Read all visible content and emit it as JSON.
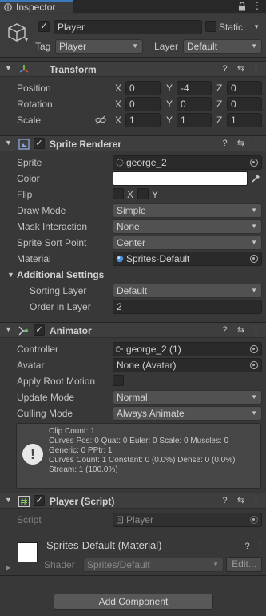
{
  "window": {
    "tab_title": "Inspector"
  },
  "object": {
    "name": "Player",
    "active": true,
    "static_label": "Static",
    "static_checked": false,
    "tag_label": "Tag",
    "tag_value": "Player",
    "layer_label": "Layer",
    "layer_value": "Default"
  },
  "transform": {
    "title": "Transform",
    "rows": [
      {
        "label": "Position",
        "x": "0",
        "y": "-4",
        "z": "0"
      },
      {
        "label": "Rotation",
        "x": "0",
        "y": "0",
        "z": "0"
      },
      {
        "label": "Scale",
        "x": "1",
        "y": "1",
        "z": "1"
      }
    ]
  },
  "sprite_renderer": {
    "title": "Sprite Renderer",
    "sprite_label": "Sprite",
    "sprite_value": "george_2",
    "color_label": "Color",
    "flip_label": "Flip",
    "flip_x": "X",
    "flip_y": "Y",
    "draw_mode_label": "Draw Mode",
    "draw_mode_value": "Simple",
    "mask_label": "Mask Interaction",
    "mask_value": "None",
    "sort_point_label": "Sprite Sort Point",
    "sort_point_value": "Center",
    "material_label": "Material",
    "material_value": "Sprites-Default",
    "additional_label": "Additional Settings",
    "sorting_layer_label": "Sorting Layer",
    "sorting_layer_value": "Default",
    "order_label": "Order in Layer",
    "order_value": "2"
  },
  "animator": {
    "title": "Animator",
    "controller_label": "Controller",
    "controller_value": "george_2 (1)",
    "avatar_label": "Avatar",
    "avatar_value": "None (Avatar)",
    "root_motion_label": "Apply Root Motion",
    "update_mode_label": "Update Mode",
    "update_mode_value": "Normal",
    "culling_label": "Culling Mode",
    "culling_value": "Always Animate",
    "info_lines": [
      "Clip Count: 1",
      "Curves Pos: 0 Quat: 0 Euler: 0 Scale: 0 Muscles: 0",
      "Generic: 0 PPtr: 1",
      "Curves Count: 1 Constant: 0 (0.0%) Dense: 0 (0.0%)",
      "Stream: 1 (100.0%)"
    ]
  },
  "player_script": {
    "title": "Player (Script)",
    "script_label": "Script",
    "script_value": "Player"
  },
  "material": {
    "title": "Sprites-Default (Material)",
    "shader_label": "Shader",
    "shader_value": "Sprites/Default",
    "edit_label": "Edit..."
  },
  "add_component_label": "Add Component",
  "icons": {
    "help": "?",
    "presets": "⇆",
    "menu": "⋮",
    "check": "✓",
    "fold_open": "▼",
    "fold_closed": "▶",
    "dropdown": "▼"
  },
  "colors": {
    "background": "#383838",
    "header": "#3e3e3e",
    "field": "#2a2a2a",
    "accent": "#3a79bb"
  }
}
